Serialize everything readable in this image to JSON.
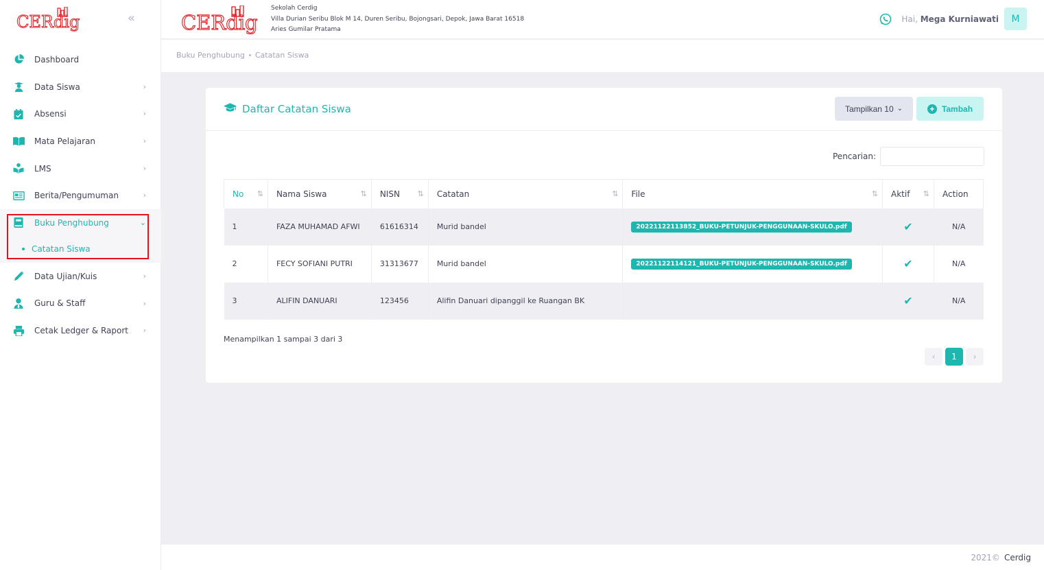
{
  "brand": {
    "logo_text": "CERdig"
  },
  "header": {
    "school_name": "Sekolah Cerdig",
    "school_address": "Villa Durian Seribu Blok M 14, Duren Seribu, Bojongsari, Depok, Jawa Barat 16518",
    "school_person": "Aries Gumilar Pratama",
    "greeting": "Hai,",
    "user_name": "Mega Kurniawati",
    "avatar_initial": "M"
  },
  "sidebar": {
    "items": [
      {
        "label": "Dashboard",
        "icon": "pie-chart-icon"
      },
      {
        "label": "Data Siswa",
        "icon": "student-icon"
      },
      {
        "label": "Absensi",
        "icon": "calendar-check-icon"
      },
      {
        "label": "Mata Pelajaran",
        "icon": "book-open-icon"
      },
      {
        "label": "LMS",
        "icon": "reader-icon"
      },
      {
        "label": "Berita/Pengumuman",
        "icon": "newspaper-icon"
      },
      {
        "label": "Buku Penghubung",
        "icon": "book-icon"
      },
      {
        "label": "Data Ujian/Kuis",
        "icon": "pencil-icon"
      },
      {
        "label": "Guru & Staff",
        "icon": "user-tie-icon"
      },
      {
        "label": "Cetak Ledger & Raport",
        "icon": "printer-icon"
      }
    ],
    "sub_item": "Catatan Siswa"
  },
  "breadcrumb": {
    "parent": "Buku Penghubung",
    "current": "Catatan Siswa"
  },
  "card": {
    "title": "Daftar Catatan Siswa",
    "show_button": "Tampilkan 10",
    "add_button": "Tambah",
    "search_label": "Pencarian:"
  },
  "table": {
    "headers": [
      "No",
      "Nama Siswa",
      "NISN",
      "Catatan",
      "File",
      "Aktif",
      "Action"
    ],
    "rows": [
      {
        "no": "1",
        "name": "FAZA MUHAMAD AFWI",
        "nisn": "61616314",
        "note": "Murid bandel",
        "file": "20221122113852_BUKU-PETUNJUK-PENGGUNAAN-SKULO.pdf",
        "action": "N/A"
      },
      {
        "no": "2",
        "name": "FECY SOFIANI PUTRI",
        "nisn": "31313677",
        "note": "Murid bandel",
        "file": "20221122114121_BUKU-PETUNJUK-PENGGUNAAN-SKULO.pdf",
        "action": "N/A"
      },
      {
        "no": "3",
        "name": "ALIFIN DANUARI",
        "nisn": "123456",
        "note": "Alifin Danuari dipanggil ke Ruangan BK",
        "file": "",
        "action": "N/A"
      }
    ]
  },
  "pagination": {
    "info": "Menampilkan 1 sampai 3 dari 3",
    "current_page": "1"
  },
  "footer": {
    "year": "2021©",
    "name": "Cerdig"
  },
  "colors": {
    "accent": "#1fb6b0",
    "accent_light": "#c9f4f1",
    "highlight": "#e5121c"
  }
}
